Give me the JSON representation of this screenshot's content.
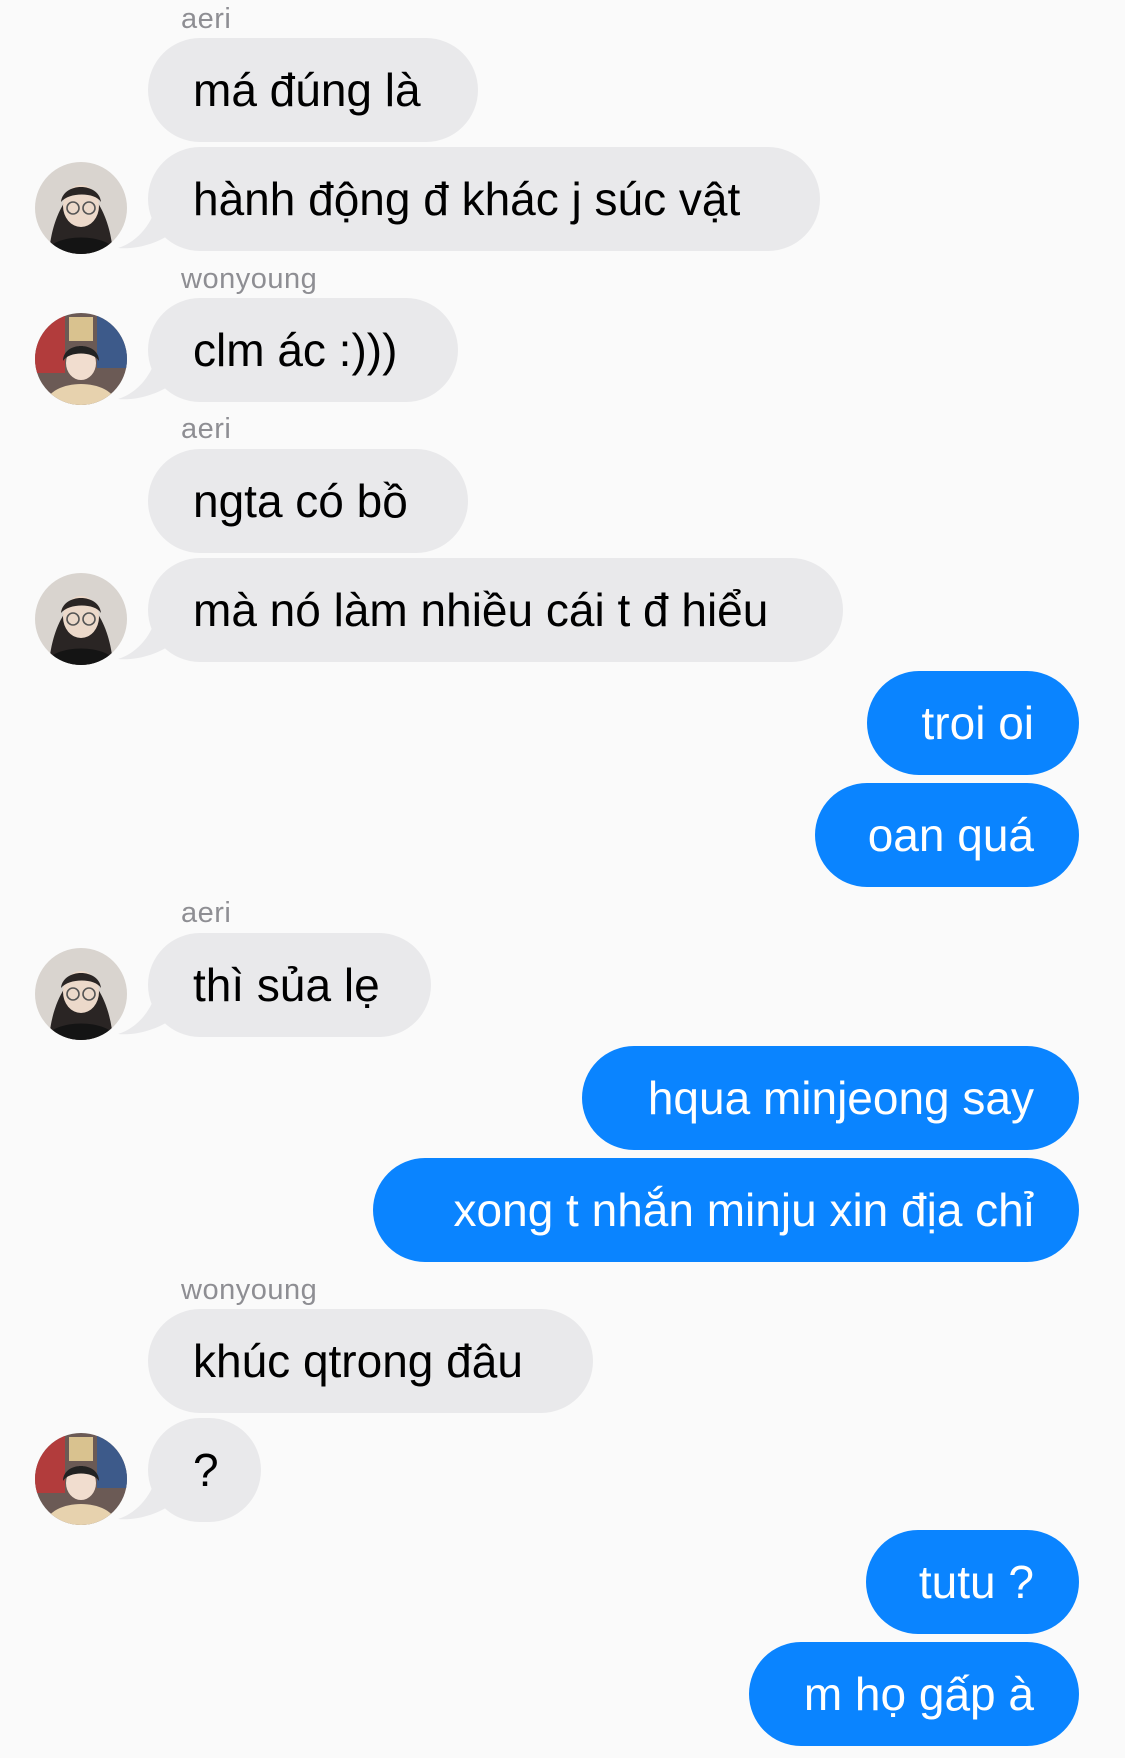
{
  "theme": {
    "incoming_bubble": "#e9e9eb",
    "outgoing_bubble": "#0a84ff",
    "background": "#fafafa",
    "sender_label": "#8e8e93"
  },
  "messages": [
    {
      "sender": "aeri",
      "text": "má đúng là"
    },
    {
      "text": "hành động đ khác j súc vật",
      "avatar": "aeri-avatar"
    },
    {
      "sender": "wonyoung",
      "text": "clm ác :)))",
      "avatar": "wonyoung-avatar"
    },
    {
      "sender": "aeri",
      "text": "ngta có bồ"
    },
    {
      "text": "mà nó làm nhiều cái t đ hiểu",
      "avatar": "aeri-avatar"
    },
    {
      "text": "troi oi",
      "outgoing": true
    },
    {
      "text": "oan quá",
      "outgoing": true
    },
    {
      "sender": "aeri",
      "text": "thì sủa lẹ",
      "avatar": "aeri-avatar"
    },
    {
      "text": "hqua minjeong say",
      "outgoing": true
    },
    {
      "text": "xong t nhắn minju xin địa chỉ",
      "outgoing": true
    },
    {
      "sender": "wonyoung",
      "text": "khúc qtrong đâu"
    },
    {
      "text": "?",
      "avatar": "wonyoung-avatar"
    },
    {
      "text": "tutu ?",
      "outgoing": true
    },
    {
      "text": "m họ gấp à",
      "outgoing": true
    }
  ]
}
